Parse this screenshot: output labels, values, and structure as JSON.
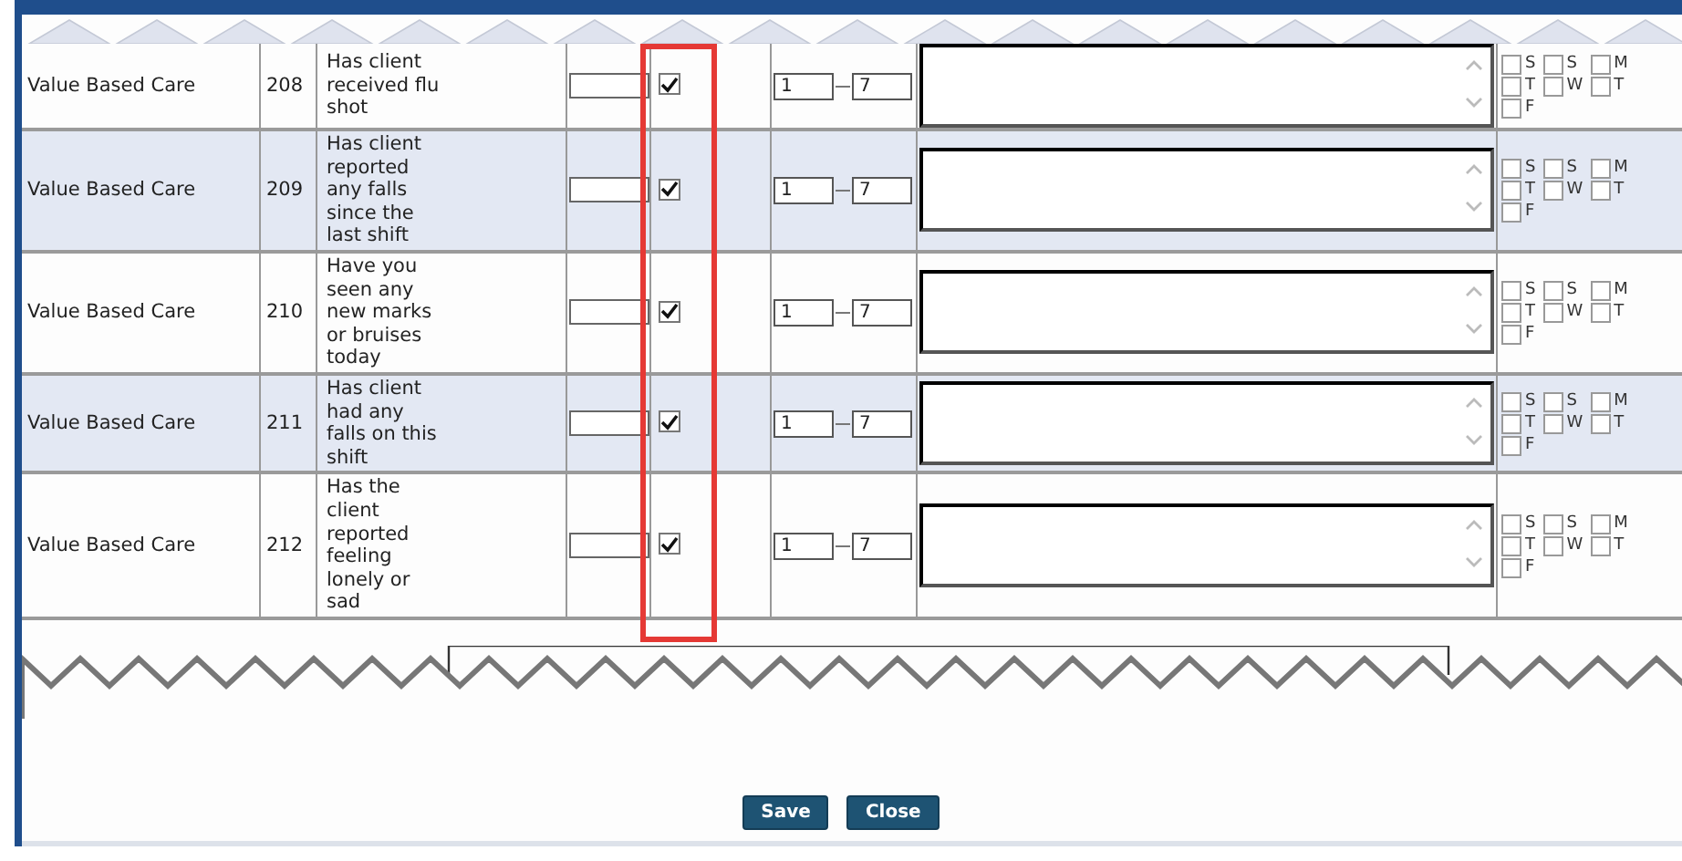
{
  "rows": [
    {
      "category": "Value Based Care",
      "code": "208",
      "question": "Has client received flu shot",
      "checked": true,
      "range_from": "1",
      "range_to": "7",
      "days": [
        {
          "label": "S",
          "checked": false
        },
        {
          "label": "S",
          "checked": false
        },
        {
          "label": "M",
          "checked": false
        },
        {
          "label": "T",
          "checked": false
        },
        {
          "label": "W",
          "checked": false
        },
        {
          "label": "T",
          "checked": false
        },
        {
          "label": "F",
          "checked": false
        }
      ]
    },
    {
      "category": "Value Based Care",
      "code": "209",
      "question": "Has client reported any falls since the last shift",
      "checked": true,
      "range_from": "1",
      "range_to": "7",
      "days": [
        {
          "label": "S",
          "checked": false
        },
        {
          "label": "S",
          "checked": false
        },
        {
          "label": "M",
          "checked": false
        },
        {
          "label": "T",
          "checked": false
        },
        {
          "label": "W",
          "checked": false
        },
        {
          "label": "T",
          "checked": false
        },
        {
          "label": "F",
          "checked": false
        }
      ]
    },
    {
      "category": "Value Based Care",
      "code": "210",
      "question": "Have you seen any new marks or bruises today",
      "checked": true,
      "range_from": "1",
      "range_to": "7",
      "days": [
        {
          "label": "S",
          "checked": false
        },
        {
          "label": "S",
          "checked": false
        },
        {
          "label": "M",
          "checked": false
        },
        {
          "label": "T",
          "checked": false
        },
        {
          "label": "W",
          "checked": false
        },
        {
          "label": "T",
          "checked": false
        },
        {
          "label": "F",
          "checked": false
        }
      ]
    },
    {
      "category": "Value Based Care",
      "code": "211",
      "question": "Has client had any falls on this shift",
      "checked": true,
      "range_from": "1",
      "range_to": "7",
      "days": [
        {
          "label": "S",
          "checked": false
        },
        {
          "label": "S",
          "checked": false
        },
        {
          "label": "M",
          "checked": false
        },
        {
          "label": "T",
          "checked": false
        },
        {
          "label": "W",
          "checked": false
        },
        {
          "label": "T",
          "checked": false
        },
        {
          "label": "F",
          "checked": false
        }
      ]
    },
    {
      "category": "Value Based Care",
      "code": "212",
      "question": "Has the client reported feeling lonely or sad",
      "checked": true,
      "range_from": "1",
      "range_to": "7",
      "days": [
        {
          "label": "S",
          "checked": false
        },
        {
          "label": "S",
          "checked": false
        },
        {
          "label": "M",
          "checked": false
        },
        {
          "label": "T",
          "checked": false
        },
        {
          "label": "W",
          "checked": false
        },
        {
          "label": "T",
          "checked": false
        },
        {
          "label": "F",
          "checked": false
        }
      ]
    }
  ],
  "buttons": [
    "Save",
    "Close"
  ]
}
